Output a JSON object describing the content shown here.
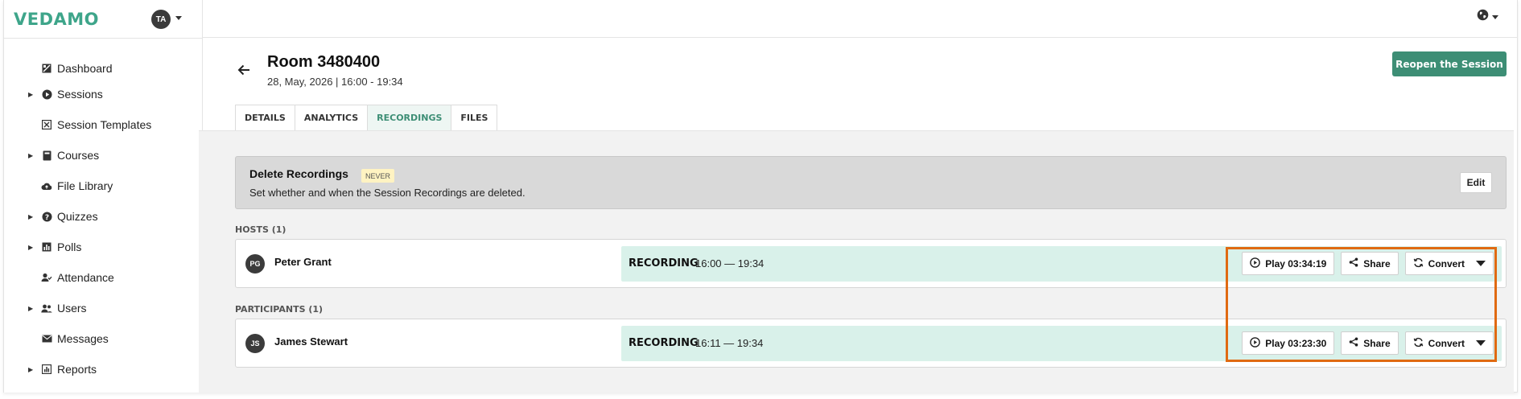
{
  "app": {
    "logo": "VEDAMO",
    "user_initials": "TA"
  },
  "sidebar": {
    "items": [
      {
        "label": "Dashboard",
        "icon": "dashboard-icon",
        "expandable": false
      },
      {
        "label": "Sessions",
        "icon": "play-circle-icon",
        "expandable": true
      },
      {
        "label": "Session Templates",
        "icon": "template-icon",
        "expandable": false
      },
      {
        "label": "Courses",
        "icon": "book-icon",
        "expandable": true
      },
      {
        "label": "File Library",
        "icon": "cloud-upload-icon",
        "expandable": false
      },
      {
        "label": "Quizzes",
        "icon": "question-circle-icon",
        "expandable": true
      },
      {
        "label": "Polls",
        "icon": "bar-chart-icon",
        "expandable": true
      },
      {
        "label": "Attendance",
        "icon": "user-check-icon",
        "expandable": false
      },
      {
        "label": "Users",
        "icon": "users-icon",
        "expandable": true
      },
      {
        "label": "Messages",
        "icon": "envelope-icon",
        "expandable": false
      },
      {
        "label": "Reports",
        "icon": "report-chart-icon",
        "expandable": true
      }
    ]
  },
  "header": {
    "title": "Room 3480400",
    "date": "28, May, 2026 | 16:00 - 19:34",
    "reopen_label": "Reopen the Session"
  },
  "tabs": [
    {
      "label": "DETAILS",
      "active": false
    },
    {
      "label": "ANALYTICS",
      "active": false
    },
    {
      "label": "RECORDINGS",
      "active": true
    },
    {
      "label": "FILES",
      "active": false
    }
  ],
  "delete_recordings": {
    "title": "Delete Recordings",
    "badge": "NEVER",
    "description": "Set whether and when the Session Recordings are deleted.",
    "edit_label": "Edit"
  },
  "hosts": {
    "label": "HOSTS (1)",
    "rows": [
      {
        "initials": "PG",
        "name": "Peter Grant",
        "rec_label": "RECORDING",
        "rec_time": "16:00 — 19:34",
        "play_label": "Play 03:34:19",
        "share_label": "Share",
        "convert_label": "Convert"
      }
    ]
  },
  "participants": {
    "label": "PARTICIPANTS (1)",
    "rows": [
      {
        "initials": "JS",
        "name": "James Stewart",
        "rec_label": "RECORDING",
        "rec_time": "16:11 — 19:34",
        "play_label": "Play 03:23:30",
        "share_label": "Share",
        "convert_label": "Convert"
      }
    ]
  },
  "colors": {
    "brand": "#3ea58a",
    "accent": "#3d8e75",
    "highlight": "#e06a12",
    "recording_strip": "#d9f1ea"
  }
}
